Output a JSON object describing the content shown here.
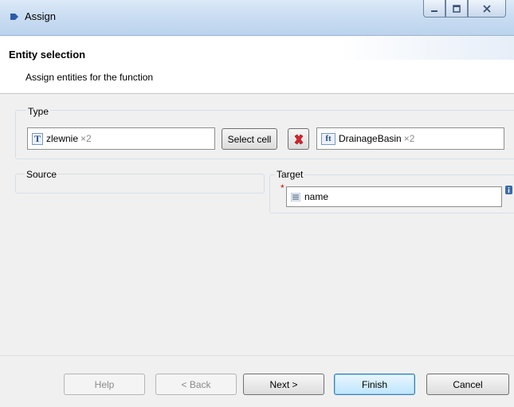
{
  "window": {
    "title": "Assign"
  },
  "header": {
    "title": "Entity selection",
    "description": "Assign entities for the function"
  },
  "type_group": {
    "label": "Type",
    "source_entity": {
      "icon": "T",
      "name": "zlewnie",
      "multiplicity": "×2"
    },
    "select_cell_label": "Select cell",
    "target_entity": {
      "icon": "ft",
      "name": "DrainageBasin",
      "multiplicity": "×2"
    }
  },
  "source_group": {
    "label": "Source"
  },
  "target_group": {
    "label": "Target",
    "required_marker": "*",
    "entity": {
      "name": "name"
    }
  },
  "buttons": {
    "help": "Help",
    "back": "< Back",
    "next": "Next >",
    "finish": "Finish",
    "cancel": "Cancel"
  },
  "colors": {
    "delete_icon": "#d9232d",
    "accent_border": "#3c7fb1"
  }
}
